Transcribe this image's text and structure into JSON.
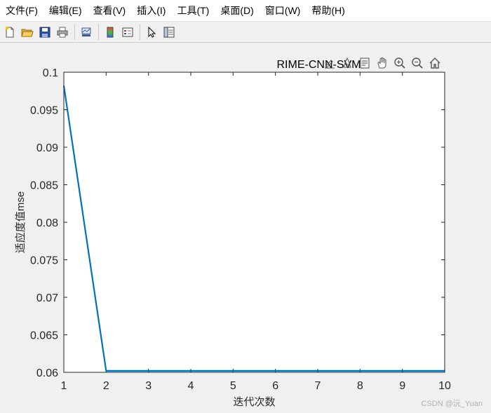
{
  "menu": {
    "items": [
      "文件(F)",
      "编辑(E)",
      "查看(V)",
      "插入(I)",
      "工具(T)",
      "桌面(D)",
      "窗口(W)",
      "帮助(H)"
    ]
  },
  "toolbar": {
    "icons": [
      "new-figure-icon",
      "open-file-icon",
      "save-icon",
      "print-icon",
      "link-plot-icon",
      "insert-colorbar-icon",
      "insert-legend-icon",
      "edit-plot-icon",
      "property-inspector-icon"
    ]
  },
  "axes_toolbar": {
    "icons": [
      "brush-icon",
      "data-cursor-icon",
      "datatip-icon",
      "pan-icon",
      "zoom-in-icon",
      "zoom-out-icon",
      "home-icon"
    ]
  },
  "chart_data": {
    "type": "line",
    "title": "RIME-CNN-SVM",
    "xlabel": "迭代次数",
    "ylabel": "适应度值mse",
    "x": [
      1,
      2,
      3,
      4,
      5,
      6,
      7,
      8,
      9,
      10
    ],
    "series": [
      {
        "values": [
          0.0982,
          0.0602,
          0.0602,
          0.0602,
          0.0602,
          0.0602,
          0.0602,
          0.0602,
          0.0602,
          0.0602
        ],
        "color": "#0072bd"
      }
    ],
    "xlim": [
      1,
      10
    ],
    "ylim": [
      0.06,
      0.1
    ],
    "xticks": [
      "1",
      "2",
      "3",
      "4",
      "5",
      "6",
      "7",
      "8",
      "9",
      "10"
    ],
    "yticks": [
      "0.06",
      "0.065",
      "0.07",
      "0.075",
      "0.08",
      "0.085",
      "0.09",
      "0.095",
      "0.1"
    ],
    "grid": false,
    "box": true
  },
  "watermark": "CSDN @沅_Yuan"
}
